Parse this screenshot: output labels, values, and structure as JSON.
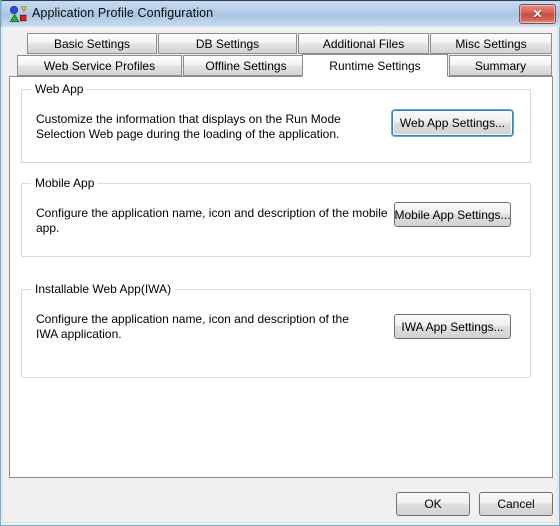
{
  "window": {
    "title": "Application Profile Configuration",
    "icon": "application-profile-icon",
    "close_label": "✕",
    "accent_blue": "#3c7fb1",
    "titlebar_gradient_top": "#c8daee",
    "titlebar_gradient_bottom": "#dce9f7",
    "close_button_red": "#c44a42"
  },
  "tabs": {
    "row1": [
      {
        "label": "Basic Settings",
        "selected": false
      },
      {
        "label": "DB Settings",
        "selected": false
      },
      {
        "label": "Additional Files",
        "selected": false
      },
      {
        "label": "Misc Settings",
        "selected": false
      }
    ],
    "row2": [
      {
        "label": "Web Service Profiles",
        "selected": false
      },
      {
        "label": "Offline Settings",
        "selected": false
      },
      {
        "label": "Runtime Settings",
        "selected": true
      },
      {
        "label": "Summary",
        "selected": false
      }
    ]
  },
  "groups": [
    {
      "legend": "Web App",
      "description": "Customize the information that displays on the Run Mode Selection Web page during the loading of the application.",
      "button_label": "Web App Settings...",
      "button_focused": true
    },
    {
      "legend": "Mobile App",
      "description": "Configure the application name, icon and description of the mobile app.",
      "button_label": "Mobile App Settings...",
      "button_focused": false
    },
    {
      "legend": "Installable Web App(IWA)",
      "description": "Configure the application name, icon and description of the IWA application.",
      "button_label": "IWA App Settings...",
      "button_focused": false
    }
  ],
  "footer": {
    "ok_label": "OK",
    "cancel_label": "Cancel"
  }
}
